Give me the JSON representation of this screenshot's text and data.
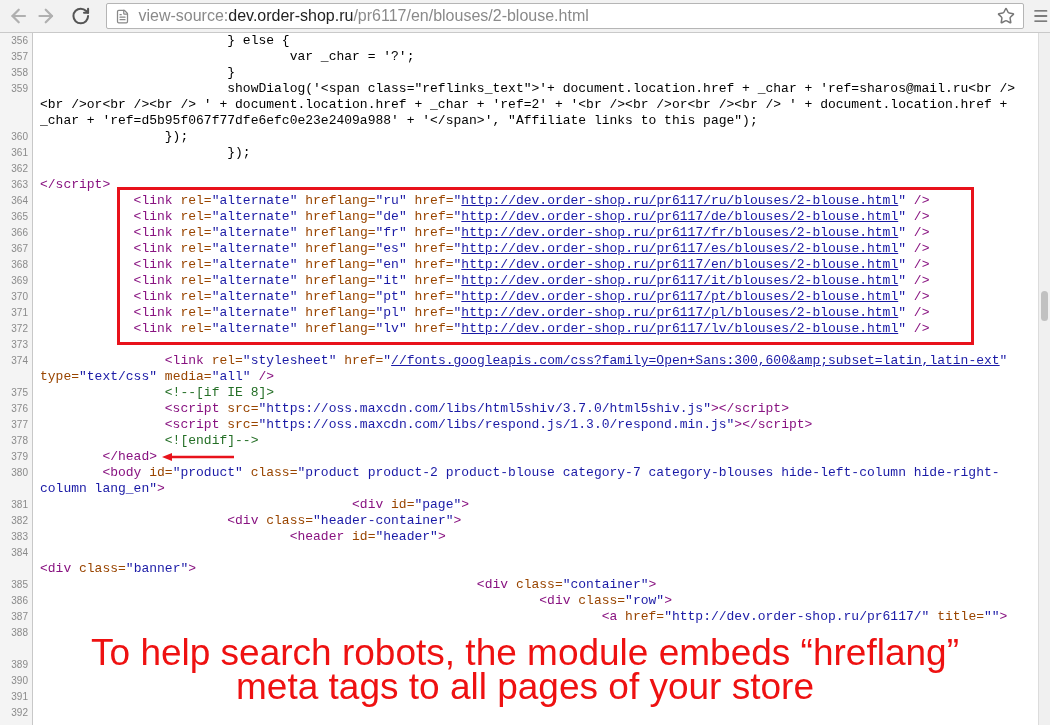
{
  "toolbar": {
    "address": {
      "scheme": "view-source:",
      "host": "dev.order-shop.ru",
      "path": "/pr6117/en/blouses/2-blouse.html"
    }
  },
  "code": {
    "blocks": [
      {
        "boxed": false,
        "arrow": false,
        "lines": [
          {
            "number": "356",
            "rows": [
              {
                "tokens": [
                  {
                    "kind": "text",
                    "text": "                        } else {"
                  }
                ]
              }
            ]
          },
          {
            "number": "357",
            "rows": [
              {
                "tokens": [
                  {
                    "kind": "text",
                    "text": "                                var _char = '?';"
                  }
                ]
              }
            ]
          },
          {
            "number": "358",
            "rows": [
              {
                "tokens": [
                  {
                    "kind": "text",
                    "text": "                        }"
                  }
                ]
              }
            ]
          },
          {
            "number": "359",
            "rows": [
              {
                "tokens": [
                  {
                    "kind": "text",
                    "text": "                        showDialog('<span class=\"reflinks_text\">'+ document.location.href + _char + 'ref=sharos@mail.ru<br />"
                  }
                ]
              },
              {
                "tokens": [
                  {
                    "kind": "text",
                    "text": "<br />or<br /><br /> ' + document.location.href + _char + 'ref=2' + '<br /><br />or<br /><br /> ' + document.location.href +"
                  }
                ]
              },
              {
                "tokens": [
                  {
                    "kind": "text",
                    "text": "_char + 'ref=d5b95f067f77dfe6efc0e23e2409a988' + '</span>', \"Affiliate links to this page\");"
                  }
                ]
              }
            ]
          },
          {
            "number": "360",
            "rows": [
              {
                "tokens": [
                  {
                    "kind": "text",
                    "text": "                });"
                  }
                ]
              }
            ]
          },
          {
            "number": "361",
            "rows": [
              {
                "tokens": [
                  {
                    "kind": "text",
                    "text": "                        });"
                  }
                ]
              }
            ]
          },
          {
            "number": "362",
            "rows": [
              {
                "tokens": []
              }
            ]
          },
          {
            "number": "363",
            "rows": [
              {
                "tokens": [
                  {
                    "kind": "tag",
                    "text": "</script>"
                  }
                ]
              }
            ]
          }
        ]
      },
      {
        "boxed": true,
        "arrow": false,
        "lines": [
          {
            "number": "364",
            "rows": [
              {
                "tokens": [
                  {
                    "kind": "tag",
                    "text": "            <link "
                  },
                  {
                    "kind": "attr",
                    "text": "rel="
                  },
                  {
                    "kind": "value",
                    "text": "\"alternate\""
                  },
                  {
                    "kind": "attr",
                    "text": " hreflang="
                  },
                  {
                    "kind": "value",
                    "text": "\"ru\""
                  },
                  {
                    "kind": "attr",
                    "text": " href="
                  },
                  {
                    "kind": "value",
                    "text": "\""
                  },
                  {
                    "kind": "link",
                    "text": "http://dev.order-shop.ru/pr6117/ru/blouses/2-blouse.html"
                  },
                  {
                    "kind": "value",
                    "text": "\""
                  },
                  {
                    "kind": "tag",
                    "text": " />"
                  }
                ]
              }
            ]
          },
          {
            "number": "365",
            "rows": [
              {
                "tokens": [
                  {
                    "kind": "tag",
                    "text": "            <link "
                  },
                  {
                    "kind": "attr",
                    "text": "rel="
                  },
                  {
                    "kind": "value",
                    "text": "\"alternate\""
                  },
                  {
                    "kind": "attr",
                    "text": " hreflang="
                  },
                  {
                    "kind": "value",
                    "text": "\"de\""
                  },
                  {
                    "kind": "attr",
                    "text": " href="
                  },
                  {
                    "kind": "value",
                    "text": "\""
                  },
                  {
                    "kind": "link",
                    "text": "http://dev.order-shop.ru/pr6117/de/blouses/2-blouse.html"
                  },
                  {
                    "kind": "value",
                    "text": "\""
                  },
                  {
                    "kind": "tag",
                    "text": " />"
                  }
                ]
              }
            ]
          },
          {
            "number": "366",
            "rows": [
              {
                "tokens": [
                  {
                    "kind": "tag",
                    "text": "            <link "
                  },
                  {
                    "kind": "attr",
                    "text": "rel="
                  },
                  {
                    "kind": "value",
                    "text": "\"alternate\""
                  },
                  {
                    "kind": "attr",
                    "text": " hreflang="
                  },
                  {
                    "kind": "value",
                    "text": "\"fr\""
                  },
                  {
                    "kind": "attr",
                    "text": " href="
                  },
                  {
                    "kind": "value",
                    "text": "\""
                  },
                  {
                    "kind": "link",
                    "text": "http://dev.order-shop.ru/pr6117/fr/blouses/2-blouse.html"
                  },
                  {
                    "kind": "value",
                    "text": "\""
                  },
                  {
                    "kind": "tag",
                    "text": " />"
                  }
                ]
              }
            ]
          },
          {
            "number": "367",
            "rows": [
              {
                "tokens": [
                  {
                    "kind": "tag",
                    "text": "            <link "
                  },
                  {
                    "kind": "attr",
                    "text": "rel="
                  },
                  {
                    "kind": "value",
                    "text": "\"alternate\""
                  },
                  {
                    "kind": "attr",
                    "text": " hreflang="
                  },
                  {
                    "kind": "value",
                    "text": "\"es\""
                  },
                  {
                    "kind": "attr",
                    "text": " href="
                  },
                  {
                    "kind": "value",
                    "text": "\""
                  },
                  {
                    "kind": "link",
                    "text": "http://dev.order-shop.ru/pr6117/es/blouses/2-blouse.html"
                  },
                  {
                    "kind": "value",
                    "text": "\""
                  },
                  {
                    "kind": "tag",
                    "text": " />"
                  }
                ]
              }
            ]
          },
          {
            "number": "368",
            "rows": [
              {
                "tokens": [
                  {
                    "kind": "tag",
                    "text": "            <link "
                  },
                  {
                    "kind": "attr",
                    "text": "rel="
                  },
                  {
                    "kind": "value",
                    "text": "\"alternate\""
                  },
                  {
                    "kind": "attr",
                    "text": " hreflang="
                  },
                  {
                    "kind": "value",
                    "text": "\"en\""
                  },
                  {
                    "kind": "attr",
                    "text": " href="
                  },
                  {
                    "kind": "value",
                    "text": "\""
                  },
                  {
                    "kind": "link",
                    "text": "http://dev.order-shop.ru/pr6117/en/blouses/2-blouse.html"
                  },
                  {
                    "kind": "value",
                    "text": "\""
                  },
                  {
                    "kind": "tag",
                    "text": " />"
                  }
                ]
              }
            ]
          },
          {
            "number": "369",
            "rows": [
              {
                "tokens": [
                  {
                    "kind": "tag",
                    "text": "            <link "
                  },
                  {
                    "kind": "attr",
                    "text": "rel="
                  },
                  {
                    "kind": "value",
                    "text": "\"alternate\""
                  },
                  {
                    "kind": "attr",
                    "text": " hreflang="
                  },
                  {
                    "kind": "value",
                    "text": "\"it\""
                  },
                  {
                    "kind": "attr",
                    "text": " href="
                  },
                  {
                    "kind": "value",
                    "text": "\""
                  },
                  {
                    "kind": "link",
                    "text": "http://dev.order-shop.ru/pr6117/it/blouses/2-blouse.html"
                  },
                  {
                    "kind": "value",
                    "text": "\""
                  },
                  {
                    "kind": "tag",
                    "text": " />"
                  }
                ]
              }
            ]
          },
          {
            "number": "370",
            "rows": [
              {
                "tokens": [
                  {
                    "kind": "tag",
                    "text": "            <link "
                  },
                  {
                    "kind": "attr",
                    "text": "rel="
                  },
                  {
                    "kind": "value",
                    "text": "\"alternate\""
                  },
                  {
                    "kind": "attr",
                    "text": " hreflang="
                  },
                  {
                    "kind": "value",
                    "text": "\"pt\""
                  },
                  {
                    "kind": "attr",
                    "text": " href="
                  },
                  {
                    "kind": "value",
                    "text": "\""
                  },
                  {
                    "kind": "link",
                    "text": "http://dev.order-shop.ru/pr6117/pt/blouses/2-blouse.html"
                  },
                  {
                    "kind": "value",
                    "text": "\""
                  },
                  {
                    "kind": "tag",
                    "text": " />"
                  }
                ]
              }
            ]
          },
          {
            "number": "371",
            "rows": [
              {
                "tokens": [
                  {
                    "kind": "tag",
                    "text": "            <link "
                  },
                  {
                    "kind": "attr",
                    "text": "rel="
                  },
                  {
                    "kind": "value",
                    "text": "\"alternate\""
                  },
                  {
                    "kind": "attr",
                    "text": " hreflang="
                  },
                  {
                    "kind": "value",
                    "text": "\"pl\""
                  },
                  {
                    "kind": "attr",
                    "text": " href="
                  },
                  {
                    "kind": "value",
                    "text": "\""
                  },
                  {
                    "kind": "link",
                    "text": "http://dev.order-shop.ru/pr6117/pl/blouses/2-blouse.html"
                  },
                  {
                    "kind": "value",
                    "text": "\""
                  },
                  {
                    "kind": "tag",
                    "text": " />"
                  }
                ]
              }
            ]
          },
          {
            "number": "372",
            "rows": [
              {
                "tokens": [
                  {
                    "kind": "tag",
                    "text": "            <link "
                  },
                  {
                    "kind": "attr",
                    "text": "rel="
                  },
                  {
                    "kind": "value",
                    "text": "\"alternate\""
                  },
                  {
                    "kind": "attr",
                    "text": " hreflang="
                  },
                  {
                    "kind": "value",
                    "text": "\"lv\""
                  },
                  {
                    "kind": "attr",
                    "text": " href="
                  },
                  {
                    "kind": "value",
                    "text": "\""
                  },
                  {
                    "kind": "link",
                    "text": "http://dev.order-shop.ru/pr6117/lv/blouses/2-blouse.html"
                  },
                  {
                    "kind": "value",
                    "text": "\""
                  },
                  {
                    "kind": "tag",
                    "text": " />"
                  }
                ]
              }
            ]
          }
        ]
      },
      {
        "boxed": false,
        "arrow": false,
        "lines": [
          {
            "number": "373",
            "rows": [
              {
                "tokens": []
              }
            ]
          },
          {
            "number": "374",
            "rows": [
              {
                "tokens": [
                  {
                    "kind": "tag",
                    "text": "                <link "
                  },
                  {
                    "kind": "attr",
                    "text": "rel="
                  },
                  {
                    "kind": "value",
                    "text": "\"stylesheet\""
                  },
                  {
                    "kind": "attr",
                    "text": " href="
                  },
                  {
                    "kind": "value",
                    "text": "\""
                  },
                  {
                    "kind": "link",
                    "text": "//fonts.googleapis.com/css?family=Open+Sans:300,600&amp;subset=latin,latin-ext"
                  },
                  {
                    "kind": "value",
                    "text": "\""
                  }
                ]
              },
              {
                "tokens": [
                  {
                    "kind": "attr",
                    "text": "type="
                  },
                  {
                    "kind": "value",
                    "text": "\"text/css\""
                  },
                  {
                    "kind": "attr",
                    "text": " media="
                  },
                  {
                    "kind": "value",
                    "text": "\"all\""
                  },
                  {
                    "kind": "tag",
                    "text": " />"
                  }
                ]
              }
            ]
          },
          {
            "number": "375",
            "rows": [
              {
                "tokens": [
                  {
                    "kind": "comment",
                    "text": "                <!--[if IE 8]>"
                  }
                ]
              }
            ]
          },
          {
            "number": "376",
            "rows": [
              {
                "tokens": [
                  {
                    "kind": "tag",
                    "text": "                <script "
                  },
                  {
                    "kind": "attr",
                    "text": "src="
                  },
                  {
                    "kind": "value",
                    "text": "\"https://oss.maxcdn.com/libs/html5shiv/3.7.0/html5shiv.js\""
                  },
                  {
                    "kind": "tag",
                    "text": "></script>"
                  }
                ]
              }
            ]
          },
          {
            "number": "377",
            "rows": [
              {
                "tokens": [
                  {
                    "kind": "tag",
                    "text": "                <script "
                  },
                  {
                    "kind": "attr",
                    "text": "src="
                  },
                  {
                    "kind": "value",
                    "text": "\"https://oss.maxcdn.com/libs/respond.js/1.3.0/respond.min.js\""
                  },
                  {
                    "kind": "tag",
                    "text": "></script>"
                  }
                ]
              }
            ]
          },
          {
            "number": "378",
            "rows": [
              {
                "tokens": [
                  {
                    "kind": "comment",
                    "text": "                <![endif]-->"
                  }
                ]
              }
            ]
          }
        ]
      },
      {
        "boxed": false,
        "arrow": true,
        "lines": [
          {
            "number": "379",
            "rows": [
              {
                "tokens": [
                  {
                    "kind": "tag",
                    "text": "        </head>"
                  }
                ]
              }
            ]
          }
        ]
      },
      {
        "boxed": false,
        "arrow": false,
        "lines": [
          {
            "number": "380",
            "rows": [
              {
                "tokens": [
                  {
                    "kind": "tag",
                    "text": "        <body "
                  },
                  {
                    "kind": "attr",
                    "text": "id="
                  },
                  {
                    "kind": "value",
                    "text": "\"product\""
                  },
                  {
                    "kind": "attr",
                    "text": " class="
                  },
                  {
                    "kind": "value",
                    "text": "\"product product-2 product-blouse category-7 category-blouses hide-left-column hide-right-"
                  }
                ]
              },
              {
                "tokens": [
                  {
                    "kind": "value",
                    "text": "column lang_en\""
                  },
                  {
                    "kind": "tag",
                    "text": ">"
                  }
                ]
              }
            ]
          },
          {
            "number": "381",
            "rows": [
              {
                "tokens": [
                  {
                    "kind": "tag",
                    "text": "                                        <div "
                  },
                  {
                    "kind": "attr",
                    "text": "id="
                  },
                  {
                    "kind": "value",
                    "text": "\"page\""
                  },
                  {
                    "kind": "tag",
                    "text": ">"
                  }
                ]
              }
            ]
          },
          {
            "number": "382",
            "rows": [
              {
                "tokens": [
                  {
                    "kind": "tag",
                    "text": "                        <div "
                  },
                  {
                    "kind": "attr",
                    "text": "class="
                  },
                  {
                    "kind": "value",
                    "text": "\"header-container\""
                  },
                  {
                    "kind": "tag",
                    "text": ">"
                  }
                ]
              }
            ]
          },
          {
            "number": "383",
            "rows": [
              {
                "tokens": [
                  {
                    "kind": "tag",
                    "text": "                                <header "
                  },
                  {
                    "kind": "attr",
                    "text": "id="
                  },
                  {
                    "kind": "value",
                    "text": "\"header\""
                  },
                  {
                    "kind": "tag",
                    "text": ">"
                  }
                ]
              }
            ]
          },
          {
            "number": "384",
            "rows": [
              {
                "tokens": []
              },
              {
                "tokens": [
                  {
                    "kind": "tag",
                    "text": "<div "
                  },
                  {
                    "kind": "attr",
                    "text": "class="
                  },
                  {
                    "kind": "value",
                    "text": "\"banner\""
                  },
                  {
                    "kind": "tag",
                    "text": ">"
                  }
                ]
              }
            ]
          },
          {
            "number": "385",
            "rows": [
              {
                "tokens": [
                  {
                    "kind": "tag",
                    "text": "                                                        <div "
                  },
                  {
                    "kind": "attr",
                    "text": "class="
                  },
                  {
                    "kind": "value",
                    "text": "\"container\""
                  },
                  {
                    "kind": "tag",
                    "text": ">"
                  }
                ]
              }
            ]
          },
          {
            "number": "386",
            "rows": [
              {
                "tokens": [
                  {
                    "kind": "tag",
                    "text": "                                                                <div "
                  },
                  {
                    "kind": "attr",
                    "text": "class="
                  },
                  {
                    "kind": "value",
                    "text": "\"row\""
                  },
                  {
                    "kind": "tag",
                    "text": ">"
                  }
                ]
              }
            ]
          },
          {
            "number": "387",
            "rows": [
              {
                "tokens": [
                  {
                    "kind": "tag",
                    "text": "                                                                        <a "
                  },
                  {
                    "kind": "attr",
                    "text": "href="
                  },
                  {
                    "kind": "value",
                    "text": "\"http://dev.order-shop.ru/pr6117/\""
                  },
                  {
                    "kind": "attr",
                    "text": " title="
                  },
                  {
                    "kind": "value",
                    "text": "\"\""
                  },
                  {
                    "kind": "tag",
                    "text": ">"
                  }
                ]
              }
            ]
          },
          {
            "number": "388",
            "rows": [
              {
                "tokens": []
              },
              {
                "tokens": []
              }
            ]
          },
          {
            "number": "389",
            "rows": [
              {
                "tokens": []
              }
            ]
          },
          {
            "number": "390",
            "rows": [
              {
                "tokens": []
              }
            ]
          },
          {
            "number": "391",
            "rows": [
              {
                "tokens": []
              }
            ]
          },
          {
            "number": "392",
            "rows": [
              {
                "tokens": []
              }
            ]
          }
        ]
      }
    ]
  },
  "caption": {
    "lines": [
      "To help search robots, the module embeds “hreflang”",
      "meta tags to all pages of your store"
    ]
  }
}
